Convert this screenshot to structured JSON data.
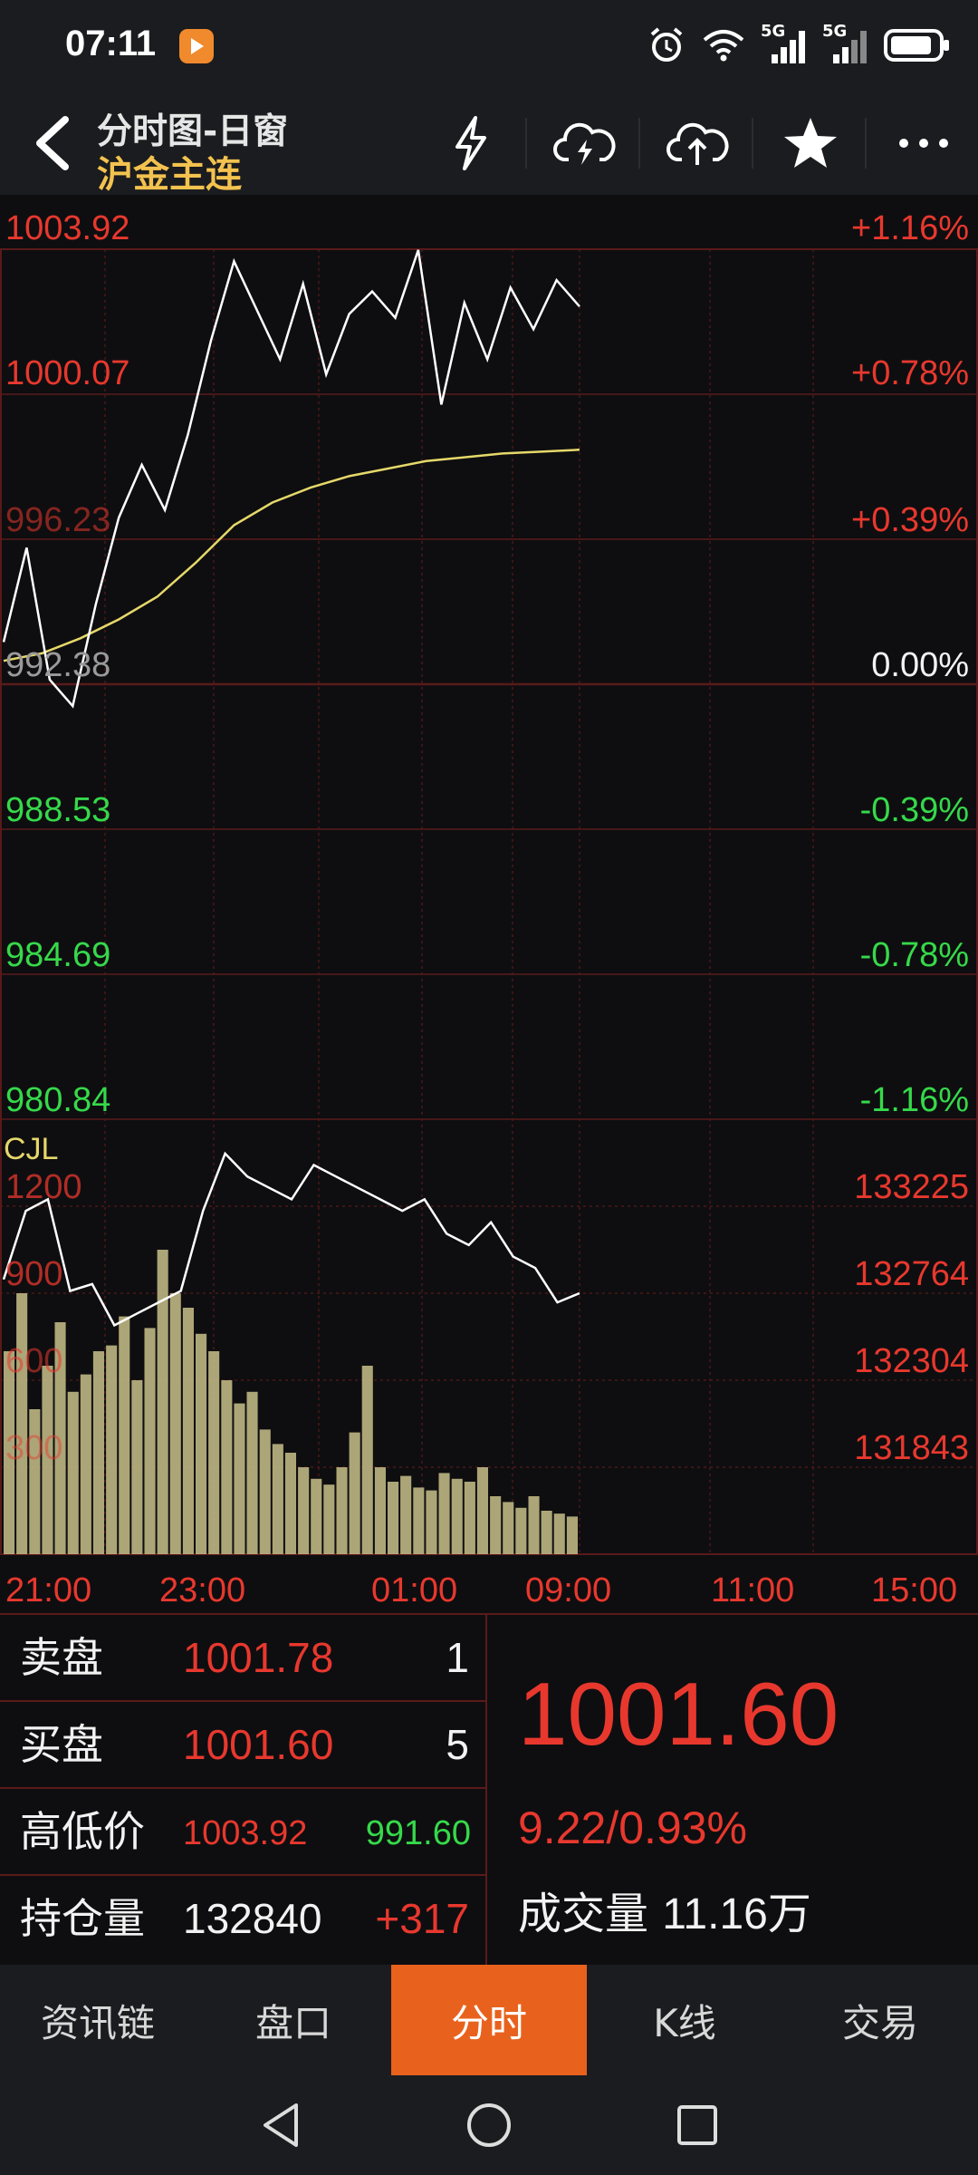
{
  "status_bar": {
    "time": "07:11",
    "signal_1_label": "5G",
    "signal_2_label": "5G",
    "icons": [
      "app-notification-icon",
      "alarm-icon",
      "wifi-icon",
      "signal-icon",
      "signal-icon",
      "battery-icon"
    ]
  },
  "header": {
    "title": "分时图-日窗",
    "instrument": "沪金主连",
    "icons": [
      "back-icon",
      "lightning-icon",
      "cloud-download-icon",
      "cloud-upload-icon",
      "star-icon",
      "more-icon"
    ]
  },
  "chart": {
    "price_labels": [
      "1003.92",
      "1000.07",
      "996.23",
      "992.38",
      "988.53",
      "984.69",
      "980.84"
    ],
    "pct_labels": [
      "+1.16%",
      "+0.78%",
      "+0.39%",
      "0.00%",
      "-0.39%",
      "-0.78%",
      "-1.16%"
    ],
    "volume_title": "CJL",
    "volume_labels": [
      "1200",
      "900",
      "600",
      "300"
    ],
    "oi_labels": [
      "133225",
      "132764",
      "132304",
      "131843"
    ],
    "x_labels": [
      "21:00",
      "23:00",
      "01:00",
      "09:00",
      "11:00",
      "15:00"
    ],
    "colors": {
      "up": "#e8382e",
      "down": "#36d94a",
      "price_line": "#ffffff",
      "avg_line": "#e6d86a",
      "volume_bars": "#c8c08a",
      "grid": "#5a1a1a"
    }
  },
  "chart_data": {
    "type": "line",
    "title": "",
    "y_range": [
      980.84,
      1003.92
    ],
    "prev_close": 992.38,
    "series": [
      {
        "name": "",
        "values": [
          993.5,
          996.0,
          992.5,
          991.8,
          994.5,
          996.8,
          998.2,
          997.0,
          999.0,
          1001.5,
          1003.6,
          1002.3,
          1001.0,
          1003.0,
          1000.6,
          1002.2,
          1002.8,
          1002.1,
          1003.9,
          999.8,
          1002.5,
          1001.0,
          1002.9,
          1001.8,
          1003.1,
          1002.4
        ]
      },
      {
        "name": "",
        "values": [
          993.0,
          993.2,
          993.6,
          994.1,
          994.7,
          995.6,
          996.6,
          997.2,
          997.6,
          997.9,
          998.1,
          998.3,
          998.4,
          998.5,
          998.55,
          998.6
        ]
      }
    ],
    "volume": {
      "labels_shown": [
        "1200",
        "900",
        "600",
        "300"
      ],
      "bars": [
        700,
        900,
        500,
        650,
        800,
        560,
        620,
        700,
        720,
        820,
        600,
        780,
        1050,
        900,
        850,
        760,
        700,
        600,
        520,
        560,
        430,
        380,
        350,
        300,
        260,
        240,
        300,
        420,
        650,
        300,
        250,
        270,
        230,
        220,
        280,
        260,
        250,
        300,
        200,
        180,
        160,
        200,
        150,
        140,
        130
      ]
    },
    "open_interest": {
      "labels_shown": [
        "133225",
        "132764",
        "132304",
        "131843"
      ],
      "values": [
        132800,
        133100,
        133150,
        132750,
        132780,
        132600,
        132650,
        132700,
        132750,
        133100,
        133350,
        133250,
        133200,
        133150,
        133300,
        133250,
        133200,
        133150,
        133100,
        133150,
        133000,
        132950,
        133050,
        132900,
        132850,
        132700,
        132740
      ]
    }
  },
  "quote": {
    "ask_label": "卖盘",
    "ask_price": "1001.78",
    "ask_qty": "1",
    "bid_label": "买盘",
    "bid_price": "1001.60",
    "bid_qty": "5",
    "hl_label": "高低价",
    "high": "1003.92",
    "low": "991.60",
    "oi_label": "持仓量",
    "oi_value": "132840",
    "oi_change": "+317",
    "last_price": "1001.60",
    "change": "9.22/0.93%",
    "volume_label": "成交量",
    "volume_value": "11.16万"
  },
  "tabs": [
    "资讯链",
    "盘口",
    "分时",
    "K线",
    "交易"
  ],
  "active_tab": "分时",
  "nav": [
    "back-nav-icon",
    "home-nav-icon",
    "recents-nav-icon"
  ]
}
